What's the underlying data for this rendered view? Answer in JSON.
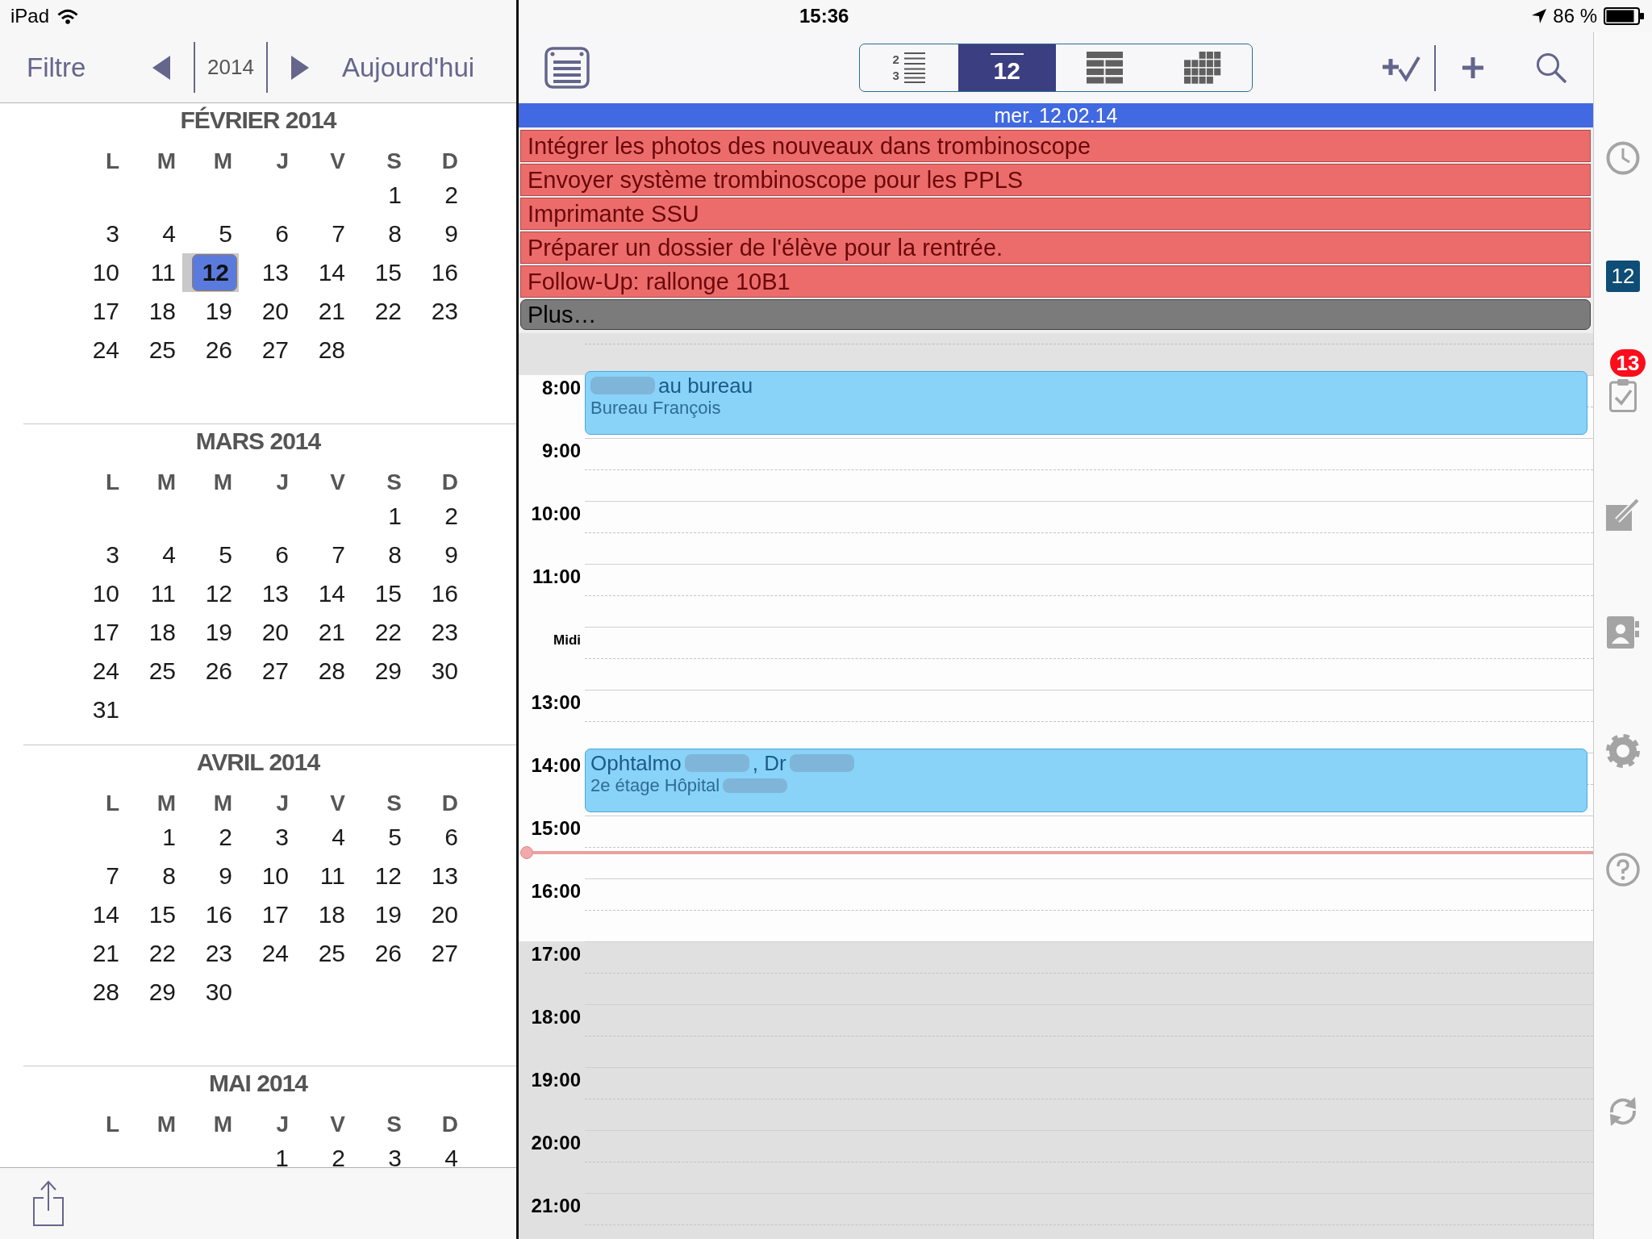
{
  "status_bar": {
    "device": "iPad",
    "time": "15:36",
    "battery": "86 %"
  },
  "calendar_panel": {
    "toolbar": {
      "filter": "Filtre",
      "year": "2014",
      "today": "Aujourd'hui"
    },
    "months": [
      {
        "title": "FÉVRIER 2014",
        "weekdays": [
          "L",
          "M",
          "M",
          "J",
          "V",
          "S",
          "D"
        ],
        "weeks": [
          {
            "kind": "first",
            "days": [
              {
                "n": "1",
                "selected": false
              },
              {
                "n": "2",
                "selected": false
              }
            ]
          },
          {
            "kind": "week",
            "days": [
              {
                "n": "3",
                "selected": false
              },
              {
                "n": "4",
                "selected": false
              },
              {
                "n": "5",
                "selected": false
              },
              {
                "n": "6",
                "selected": false
              },
              {
                "n": "7",
                "selected": false
              },
              {
                "n": "8",
                "selected": false
              },
              {
                "n": "9",
                "selected": false
              }
            ]
          },
          {
            "kind": "week",
            "days": [
              {
                "n": "10",
                "selected": false
              },
              {
                "n": "11",
                "selected": false
              },
              {
                "n": "12",
                "selected": true
              },
              {
                "n": "13",
                "selected": false
              },
              {
                "n": "14",
                "selected": false
              },
              {
                "n": "15",
                "selected": false
              },
              {
                "n": "16",
                "selected": false
              }
            ]
          },
          {
            "kind": "week",
            "days": [
              {
                "n": "17",
                "selected": false
              },
              {
                "n": "18",
                "selected": false
              },
              {
                "n": "19",
                "selected": false
              },
              {
                "n": "20",
                "selected": false
              },
              {
                "n": "21",
                "selected": false
              },
              {
                "n": "22",
                "selected": false
              },
              {
                "n": "23",
                "selected": false
              }
            ]
          },
          {
            "kind": "week",
            "days": [
              {
                "n": "24",
                "selected": false
              },
              {
                "n": "25",
                "selected": false
              },
              {
                "n": "26",
                "selected": false
              },
              {
                "n": "27",
                "selected": false
              },
              {
                "n": "28",
                "selected": false
              }
            ]
          }
        ]
      },
      {
        "title": "MARS 2014",
        "weekdays": [
          "L",
          "M",
          "M",
          "J",
          "V",
          "S",
          "D"
        ],
        "weeks": [
          {
            "kind": "first",
            "days": [
              {
                "n": "1",
                "selected": false
              },
              {
                "n": "2",
                "selected": false
              }
            ]
          },
          {
            "kind": "week",
            "days": [
              {
                "n": "3",
                "selected": false
              },
              {
                "n": "4",
                "selected": false
              },
              {
                "n": "5",
                "selected": false
              },
              {
                "n": "6",
                "selected": false
              },
              {
                "n": "7",
                "selected": false
              },
              {
                "n": "8",
                "selected": false
              },
              {
                "n": "9",
                "selected": false
              }
            ]
          },
          {
            "kind": "week",
            "days": [
              {
                "n": "10",
                "selected": false
              },
              {
                "n": "11",
                "selected": false
              },
              {
                "n": "12",
                "selected": false
              },
              {
                "n": "13",
                "selected": false
              },
              {
                "n": "14",
                "selected": false
              },
              {
                "n": "15",
                "selected": false
              },
              {
                "n": "16",
                "selected": false
              }
            ]
          },
          {
            "kind": "week",
            "days": [
              {
                "n": "17",
                "selected": false
              },
              {
                "n": "18",
                "selected": false
              },
              {
                "n": "19",
                "selected": false
              },
              {
                "n": "20",
                "selected": false
              },
              {
                "n": "21",
                "selected": false
              },
              {
                "n": "22",
                "selected": false
              },
              {
                "n": "23",
                "selected": false
              }
            ]
          },
          {
            "kind": "week",
            "days": [
              {
                "n": "24",
                "selected": false
              },
              {
                "n": "25",
                "selected": false
              },
              {
                "n": "26",
                "selected": false
              },
              {
                "n": "27",
                "selected": false
              },
              {
                "n": "28",
                "selected": false
              },
              {
                "n": "29",
                "selected": false
              },
              {
                "n": "30",
                "selected": false
              }
            ]
          },
          {
            "kind": "week",
            "days": [
              {
                "n": "31",
                "selected": false
              }
            ]
          }
        ]
      },
      {
        "title": "AVRIL 2014",
        "weekdays": [
          "L",
          "M",
          "M",
          "J",
          "V",
          "S",
          "D"
        ],
        "weeks": [
          {
            "kind": "first",
            "days": [
              {
                "n": "1",
                "selected": false
              },
              {
                "n": "2",
                "selected": false
              },
              {
                "n": "3",
                "selected": false
              },
              {
                "n": "4",
                "selected": false
              },
              {
                "n": "5",
                "selected": false
              },
              {
                "n": "6",
                "selected": false
              }
            ]
          },
          {
            "kind": "week",
            "days": [
              {
                "n": "7",
                "selected": false
              },
              {
                "n": "8",
                "selected": false
              },
              {
                "n": "9",
                "selected": false
              },
              {
                "n": "10",
                "selected": false
              },
              {
                "n": "11",
                "selected": false
              },
              {
                "n": "12",
                "selected": false
              },
              {
                "n": "13",
                "selected": false
              }
            ]
          },
          {
            "kind": "week",
            "days": [
              {
                "n": "14",
                "selected": false
              },
              {
                "n": "15",
                "selected": false
              },
              {
                "n": "16",
                "selected": false
              },
              {
                "n": "17",
                "selected": false
              },
              {
                "n": "18",
                "selected": false
              },
              {
                "n": "19",
                "selected": false
              },
              {
                "n": "20",
                "selected": false
              }
            ]
          },
          {
            "kind": "week",
            "days": [
              {
                "n": "21",
                "selected": false
              },
              {
                "n": "22",
                "selected": false
              },
              {
                "n": "23",
                "selected": false
              },
              {
                "n": "24",
                "selected": false
              },
              {
                "n": "25",
                "selected": false
              },
              {
                "n": "26",
                "selected": false
              },
              {
                "n": "27",
                "selected": false
              }
            ]
          },
          {
            "kind": "week",
            "days": [
              {
                "n": "28",
                "selected": false
              },
              {
                "n": "29",
                "selected": false
              },
              {
                "n": "30",
                "selected": false
              }
            ]
          }
        ]
      },
      {
        "title": "MAI 2014",
        "weekdays": [
          "L",
          "M",
          "M",
          "J",
          "V",
          "S",
          "D"
        ],
        "weeks": [
          {
            "kind": "first",
            "days": [
              {
                "n": "1",
                "selected": false
              },
              {
                "n": "2",
                "selected": false
              },
              {
                "n": "3",
                "selected": false
              },
              {
                "n": "4",
                "selected": false
              }
            ]
          }
        ]
      }
    ]
  },
  "main": {
    "views": [
      {
        "kind": "list",
        "digits": [
          "2",
          "3"
        ],
        "selected": false
      },
      {
        "kind": "day",
        "label": "12",
        "selected": true
      },
      {
        "kind": "week",
        "selected": false
      },
      {
        "kind": "month",
        "selected": false
      }
    ],
    "date": "mer. 12.02.14",
    "all_day_tasks": [
      {
        "title": "Intégrer les photos des nouveaux dans trombinoscope"
      },
      {
        "title": "Envoyer système trombinoscope pour les PPLS"
      },
      {
        "title": "Imprimante SSU"
      },
      {
        "title": "Préparer un dossier de l'élève pour la rentrée."
      },
      {
        "title": "Follow-Up: rallonge 10B1"
      }
    ],
    "more": "Plus…",
    "hours": [
      {
        "label": "8:00",
        "kind": "hour",
        "off_hours": false,
        "now_marker": false,
        "events": [
          {
            "title": [
              {
                "kind": "redacted"
              },
              {
                "kind": "text",
                "text": "au bureau"
              }
            ],
            "location": [
              {
                "kind": "text",
                "text": "Bureau François"
              }
            ]
          }
        ]
      },
      {
        "label": "9:00",
        "kind": "hour",
        "off_hours": false,
        "now_marker": false
      },
      {
        "label": "10:00",
        "kind": "hour",
        "off_hours": false,
        "now_marker": false
      },
      {
        "label": "11:00",
        "kind": "hour",
        "off_hours": false,
        "now_marker": false
      },
      {
        "label": "Midi",
        "kind": "noon",
        "off_hours": false,
        "now_marker": false
      },
      {
        "label": "13:00",
        "kind": "hour",
        "off_hours": false,
        "now_marker": false
      },
      {
        "label": "14:00",
        "kind": "hour",
        "off_hours": false,
        "now_marker": false,
        "events": [
          {
            "title": [
              {
                "kind": "text",
                "text": "Ophtalmo"
              },
              {
                "kind": "redacted"
              },
              {
                "kind": "text",
                "text": ", Dr"
              },
              {
                "kind": "redacted"
              }
            ],
            "location": [
              {
                "kind": "text",
                "text": "2e étage Hôpital"
              },
              {
                "kind": "redacted"
              }
            ]
          }
        ]
      },
      {
        "label": "15:00",
        "kind": "hour",
        "off_hours": false,
        "now_marker": true
      },
      {
        "label": "16:00",
        "kind": "hour",
        "off_hours": false,
        "now_marker": false
      },
      {
        "label": "17:00",
        "kind": "hour",
        "off_hours": true,
        "now_marker": false
      },
      {
        "label": "18:00",
        "kind": "hour",
        "off_hours": true,
        "now_marker": false
      },
      {
        "label": "19:00",
        "kind": "hour",
        "off_hours": true,
        "now_marker": false
      },
      {
        "label": "20:00",
        "kind": "hour",
        "off_hours": true,
        "now_marker": false
      },
      {
        "label": "21:00",
        "kind": "hour",
        "off_hours": true,
        "now_marker": false
      }
    ]
  },
  "sidebar": {
    "items": [
      {
        "kind": "clock",
        "selected": false
      },
      {
        "kind": "calendar",
        "label": "12",
        "selected": true
      },
      {
        "kind": "tasks",
        "badge": "13",
        "selected": false
      },
      {
        "kind": "notes",
        "selected": false
      },
      {
        "kind": "contacts",
        "selected": false
      },
      {
        "kind": "settings",
        "selected": false
      },
      {
        "kind": "help",
        "selected": false
      },
      {
        "kind": "sync",
        "selected": false
      }
    ]
  }
}
